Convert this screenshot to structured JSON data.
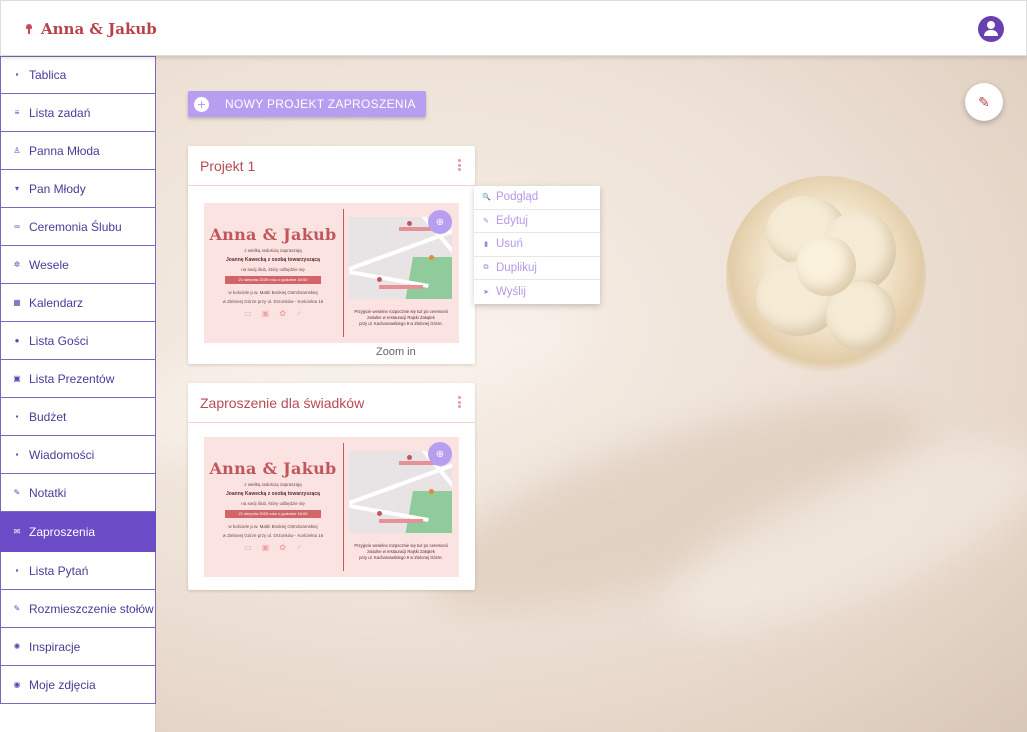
{
  "header": {
    "brand": "Anna & Jakub"
  },
  "sidebar": {
    "items": [
      {
        "label": "Tablica",
        "icon": "dashboard-icon",
        "glyph": "▪"
      },
      {
        "label": "Lista zadań",
        "icon": "list-icon",
        "glyph": "≡"
      },
      {
        "label": "Panna Młoda",
        "icon": "dress-icon",
        "glyph": "♙"
      },
      {
        "label": "Pan Młody",
        "icon": "tie-icon",
        "glyph": "▾"
      },
      {
        "label": "Ceremonia Ślubu",
        "icon": "rings-icon",
        "glyph": "∞"
      },
      {
        "label": "Wesele",
        "icon": "party-icon",
        "glyph": "✲"
      },
      {
        "label": "Kalendarz",
        "icon": "calendar-icon",
        "glyph": "▦"
      },
      {
        "label": "Lista Gości",
        "icon": "people-icon",
        "glyph": "●"
      },
      {
        "label": "Lista Prezentów",
        "icon": "gift-icon",
        "glyph": "▣"
      },
      {
        "label": "Budżet",
        "icon": "wallet-icon",
        "glyph": "▪"
      },
      {
        "label": "Wiadomości",
        "icon": "chat-icon",
        "glyph": "▪"
      },
      {
        "label": "Notatki",
        "icon": "pencil-icon",
        "glyph": "✎"
      },
      {
        "label": "Zaproszenia",
        "icon": "invitation-icon",
        "glyph": "✉",
        "active": true
      },
      {
        "label": "Lista Pytań",
        "icon": "question-icon",
        "glyph": "▪"
      },
      {
        "label": "Rozmieszczenie stołów",
        "icon": "pencil-icon",
        "glyph": "✎"
      },
      {
        "label": "Inspiracje",
        "icon": "lightbulb-icon",
        "glyph": "✺"
      },
      {
        "label": "Moje zdjęcia",
        "icon": "camera-icon",
        "glyph": "◉"
      }
    ]
  },
  "main": {
    "new_button": "NOWY PROJEKT ZAPROSZENIA",
    "zoom_tooltip": "Zoom in",
    "projects": [
      {
        "title": "Projekt 1"
      },
      {
        "title": "Zaproszenie dla świadków"
      }
    ],
    "invite": {
      "names": "Anna & Jakub",
      "line1": "z wielką radością zapraszają",
      "line2": "Joannę Kawecką z osobą towarzyszącą",
      "line3": "na swój ślub, który odbędzie się",
      "date": "21 sierpnia 2025 roku o godzinie 16:00",
      "line4": "w kościele p.w. Matki Boskiej Ostrobramskiej",
      "line5": "w Zielonej Górze przy ul. Drzonków - Kościelna 16",
      "map_text1": "Przyjęcie weselne rozpocznie się tuż po ceremonii",
      "map_text2": "zatiulne w restauracji Rajski Zakątek",
      "map_text3": "przy ul. Kachanowskiego 9 w Zielonej Górze."
    },
    "menu": [
      {
        "label": "Podgląd",
        "icon": "preview-icon",
        "glyph": "🔍"
      },
      {
        "label": "Edytuj",
        "icon": "edit-icon",
        "glyph": "✎"
      },
      {
        "label": "Usuń",
        "icon": "trash-icon",
        "glyph": "▮"
      },
      {
        "label": "Duplikuj",
        "icon": "copy-icon",
        "glyph": "⧉"
      },
      {
        "label": "Wyślij",
        "icon": "send-icon",
        "glyph": "➤"
      }
    ]
  },
  "colors": {
    "accent": "#6c4bc7",
    "brand": "#b9414b",
    "button": "#b79ef0"
  }
}
